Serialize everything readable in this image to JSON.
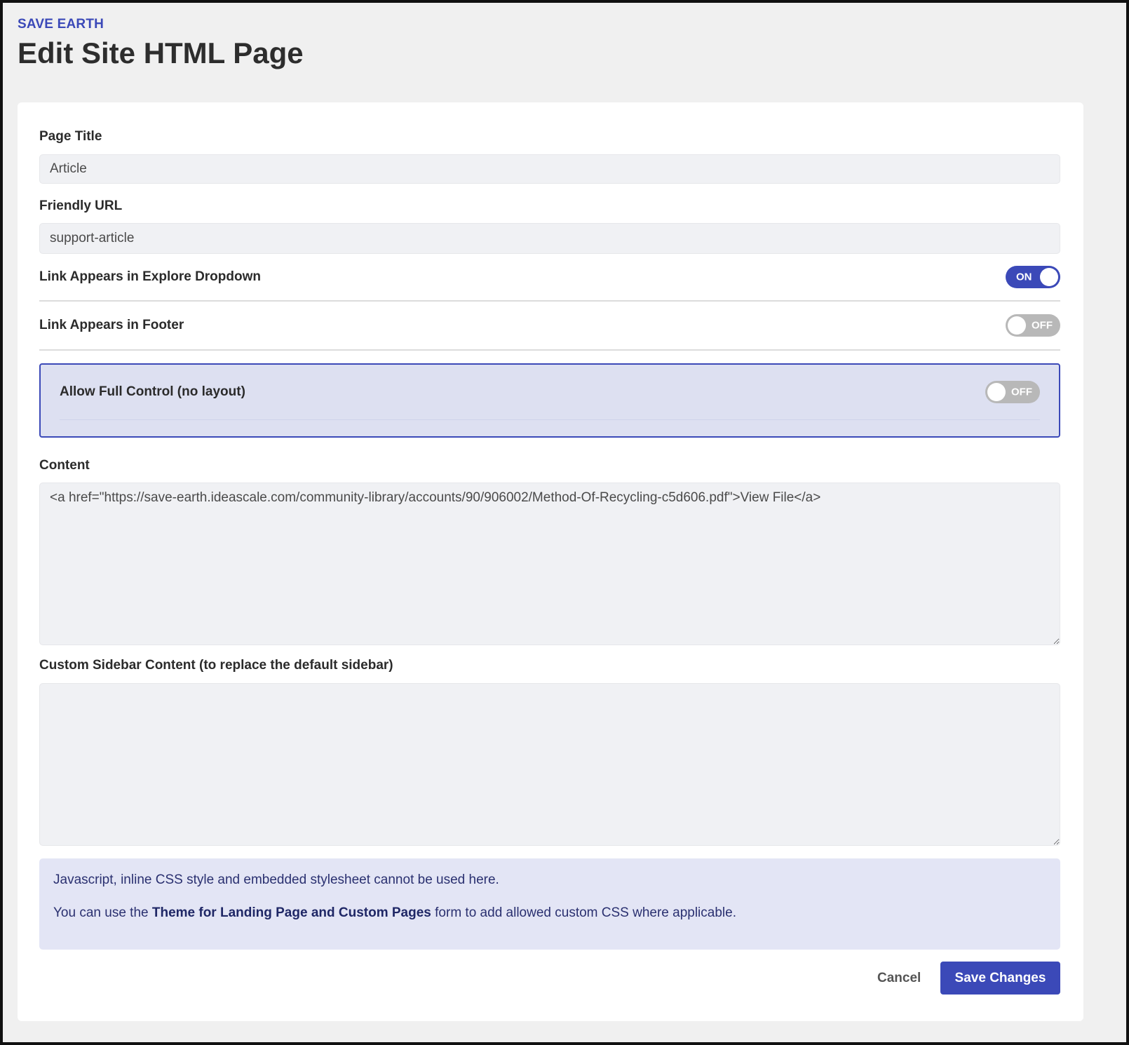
{
  "header": {
    "brand": "SAVE EARTH",
    "title": "Edit Site HTML Page"
  },
  "form": {
    "page_title": {
      "label": "Page Title",
      "value": "Article"
    },
    "friendly_url": {
      "label": "Friendly URL",
      "value": "support-article"
    },
    "explore_dropdown": {
      "label": "Link Appears in Explore Dropdown",
      "state": "ON"
    },
    "footer": {
      "label": "Link Appears in Footer",
      "state": "OFF"
    },
    "full_control": {
      "label": "Allow Full Control (no layout)",
      "state": "OFF"
    },
    "content": {
      "label": "Content",
      "value": "<a href=\"https://save-earth.ideascale.com/community-library/accounts/90/906002/Method-Of-Recycling-c5d606.pdf\">View File</a>"
    },
    "sidebar": {
      "label": "Custom Sidebar Content (to replace the default sidebar)",
      "value": ""
    }
  },
  "info": {
    "line1": "Javascript, inline CSS style and embedded stylesheet cannot be used here.",
    "line2_prefix": "You can use the ",
    "line2_link": "Theme for Landing Page and Custom Pages",
    "line2_suffix": " form to add allowed custom CSS where applicable."
  },
  "actions": {
    "cancel_label": "Cancel",
    "save_label": "Save Changes"
  },
  "colors": {
    "accent": "#3b49b8",
    "info_bg": "#e3e5f5",
    "toggle_off": "#b8b8b8"
  }
}
